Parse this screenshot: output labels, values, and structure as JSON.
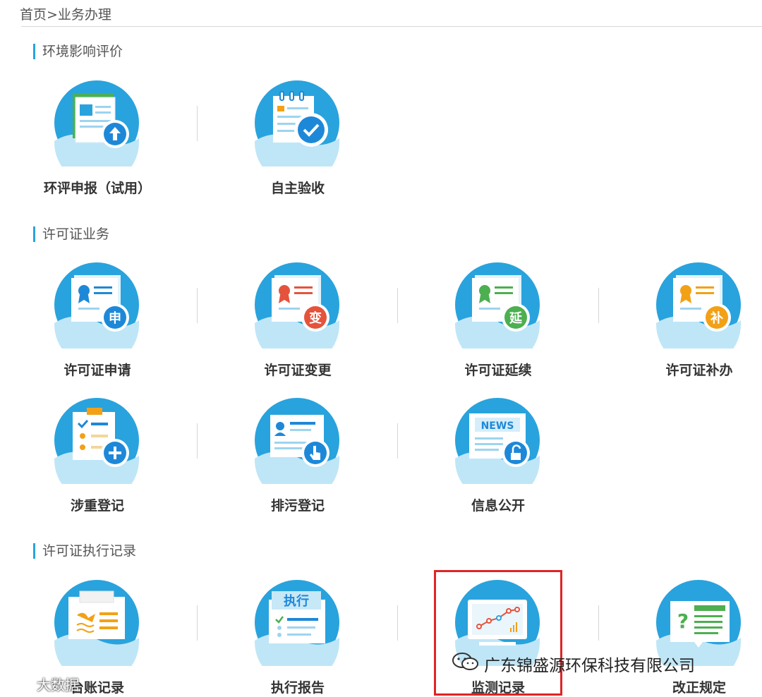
{
  "breadcrumb": "首页>业务办理",
  "sections": {
    "eia": {
      "title": "环境影响评价"
    },
    "permit": {
      "title": "许可证业务"
    },
    "exec": {
      "title": "许可证执行记录"
    }
  },
  "tiles": {
    "eia_declare": {
      "label": "环评申报（试用）",
      "icon": "upload-document-icon"
    },
    "self_acceptance": {
      "label": "自主验收",
      "icon": "checklist-check-icon"
    },
    "permit_apply": {
      "label": "许可证申请",
      "icon": "certificate-apply-icon",
      "badge": "申",
      "badge_color": "#1e88d8"
    },
    "permit_change": {
      "label": "许可证变更",
      "icon": "certificate-change-icon",
      "badge": "变",
      "badge_color": "#e5533d"
    },
    "permit_extend": {
      "label": "许可证延续",
      "icon": "certificate-extend-icon",
      "badge": "延",
      "badge_color": "#4caf50"
    },
    "permit_supplement": {
      "label": "许可证补办",
      "icon": "certificate-supplement-icon",
      "badge": "补",
      "badge_color": "#f2a116"
    },
    "heavy_register": {
      "label": "涉重登记",
      "icon": "clipboard-add-icon"
    },
    "discharge_register": {
      "label": "排污登记",
      "icon": "id-card-pointer-icon"
    },
    "info_public": {
      "label": "信息公开",
      "icon": "news-unlock-icon",
      "news_text": "NEWS"
    },
    "ledger_record": {
      "label": "台账记录",
      "icon": "ledger-book-icon"
    },
    "exec_report": {
      "label": "执行报告",
      "icon": "exec-report-icon",
      "banner_text": "执行"
    },
    "monitor_record": {
      "label": "监测记录",
      "icon": "monitor-chart-icon"
    },
    "rectify_rule": {
      "label": "改正规定",
      "icon": "question-doc-icon"
    }
  },
  "watermarks": {
    "right": "广东锦盛源环保科技有限公司",
    "left": "大数据"
  },
  "colors": {
    "circle": "#29a3dd",
    "circle_light": "#7fd0f2",
    "highlight": "#e02424"
  }
}
